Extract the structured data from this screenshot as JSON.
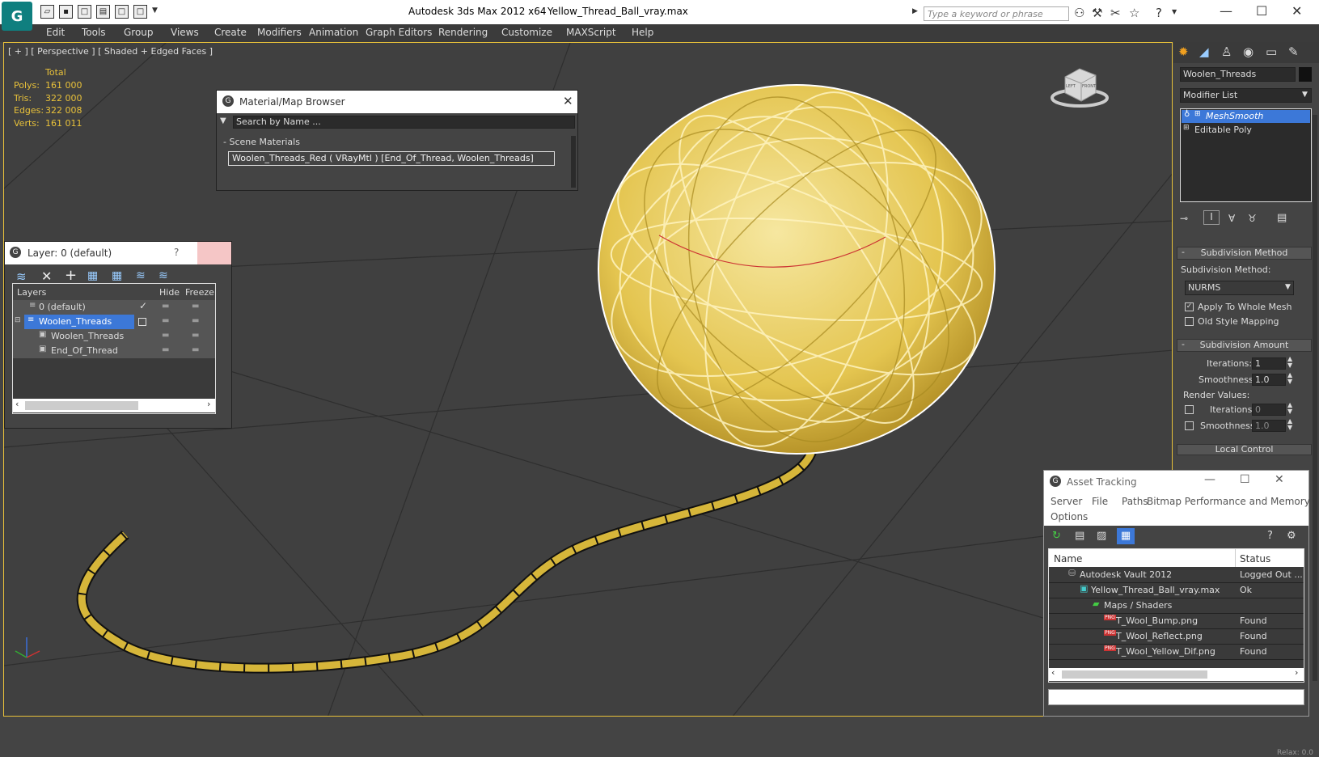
{
  "window": {
    "app_title": "Autodesk 3ds Max  2012 x64",
    "file_name": "Yellow_Thread_Ball_vray.max",
    "search_placeholder": "Type a keyword or phrase"
  },
  "menu": [
    "Edit",
    "Tools",
    "Group",
    "Views",
    "Create",
    "Modifiers",
    "Animation",
    "Graph Editors",
    "Rendering",
    "Customize",
    "MAXScript",
    "Help"
  ],
  "viewport": {
    "label": "[ + ] [ Perspective ] [ Shaded + Edged Faces ]",
    "stats": {
      "total_label": "Total",
      "rows": [
        {
          "label": "Polys:",
          "value": "161 000"
        },
        {
          "label": "Tris:",
          "value": "322 000"
        },
        {
          "label": "Edges:",
          "value": "322 008"
        },
        {
          "label": "Verts:",
          "value": "161 011"
        }
      ]
    },
    "viewcube_left": "LEFT",
    "viewcube_front": "FRONT"
  },
  "material_browser": {
    "title": "Material/Map Browser",
    "search_placeholder": "Search by Name ...",
    "section": "Scene Materials",
    "item": "Woolen_Threads_Red  ( VRayMtl )  [End_Of_Thread, Woolen_Threads]"
  },
  "layer_panel": {
    "title": "Layer: 0 (default)",
    "help": "?",
    "col_layers": "Layers",
    "col_hide": "Hide",
    "col_freeze": "Freeze",
    "rows": [
      {
        "name": "0 (default)"
      },
      {
        "name": "Woolen_Threads"
      },
      {
        "name": "Woolen_Threads"
      },
      {
        "name": "End_Of_Thread"
      }
    ]
  },
  "command_panel": {
    "object_name": "Woolen_Threads",
    "modifier_list": "Modifier List",
    "stack": [
      "MeshSmooth",
      "Editable Poly"
    ],
    "subdiv_method_title": "Subdivision Method",
    "subdiv_method_label": "Subdivision Method:",
    "subdiv_method_value": "NURMS",
    "apply_whole_mesh": "Apply To Whole Mesh",
    "old_style_mapping": "Old Style Mapping",
    "subdiv_amount_title": "Subdivision Amount",
    "iterations_label": "Iterations:",
    "iterations_value": "1",
    "smoothness_label": "Smoothness:",
    "smoothness_value": "1.0",
    "render_values_label": "Render Values:",
    "render_iterations_value": "0",
    "render_smoothness_value": "1.0",
    "local_control": "Local Control",
    "relax_value": "Relax: 0.0"
  },
  "asset_tracking": {
    "title": "Asset Tracking",
    "menu": [
      "Server",
      "File",
      "Paths",
      "Bitmap Performance and Memory",
      "Options"
    ],
    "col_name": "Name",
    "col_status": "Status",
    "rows": [
      {
        "name": "Autodesk Vault 2012",
        "status": "Logged Out ..."
      },
      {
        "name": "Yellow_Thread_Ball_vray.max",
        "status": "Ok"
      },
      {
        "name": "Maps / Shaders",
        "status": ""
      },
      {
        "name": "T_Wool_Bump.png",
        "status": "Found"
      },
      {
        "name": "T_Wool_Reflect.png",
        "status": "Found"
      },
      {
        "name": "T_Wool_Yellow_Dif.png",
        "status": "Found"
      }
    ]
  },
  "colors": {
    "accent_yellow": "#e8c13a",
    "selection_blue": "#3c78d8",
    "viewport_bg": "#404040",
    "logo_teal": "#0f7f7f"
  }
}
